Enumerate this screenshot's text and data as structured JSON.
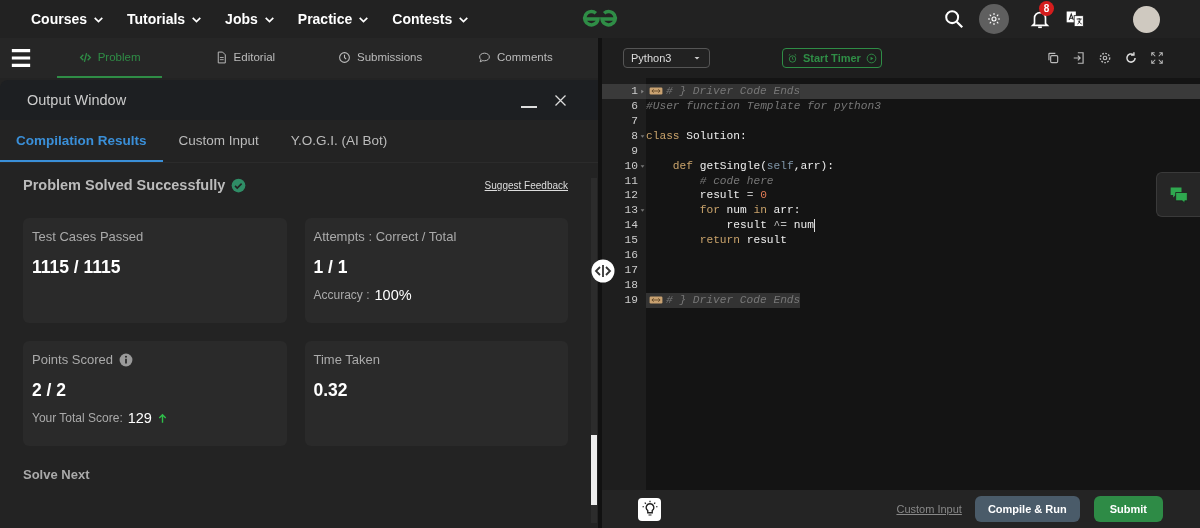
{
  "nav": {
    "menus": [
      "Courses",
      "Tutorials",
      "Jobs",
      "Practice",
      "Contests"
    ],
    "notification_count": "8"
  },
  "problem_tabs": [
    {
      "label": "Problem",
      "kind": "code",
      "selected": true
    },
    {
      "label": "Editorial",
      "kind": "document",
      "selected": false
    },
    {
      "label": "Submissions",
      "kind": "clock",
      "selected": false
    },
    {
      "label": "Comments",
      "kind": "comment",
      "selected": false
    }
  ],
  "output_window": {
    "title": "Output Window",
    "tabs": [
      {
        "label": "Compilation Results",
        "selected": true
      },
      {
        "label": "Custom Input",
        "selected": false
      },
      {
        "label": "Y.O.G.I. (AI Bot)",
        "selected": false
      }
    ],
    "status": "Problem Solved Successfully",
    "feedback_link": "Suggest Feedback",
    "cards": [
      {
        "label": "Test Cases Passed",
        "value": "1115 / 1115"
      },
      {
        "label": "Attempts : Correct / Total",
        "value": "1 / 1",
        "extra_label": "Accuracy :",
        "extra_value": "100%"
      },
      {
        "label": "Points Scored",
        "info": true,
        "value": "2 / 2",
        "extra_label": "Your Total Score:",
        "extra_value": "129",
        "rising": true
      },
      {
        "label": "Time Taken",
        "value": "0.32"
      }
    ],
    "solve_next": "Solve Next"
  },
  "editor": {
    "language": "Python3",
    "timer_button": "Start Timer",
    "lines": [
      {
        "number": "1",
        "folded": true,
        "highlighted": true,
        "folded_block": true,
        "tokens": [
          {
            "kind": "comment",
            "text": "# } Driver Code Ends"
          }
        ]
      },
      {
        "number": "6",
        "tokens": [
          {
            "kind": "comment",
            "text": "#User function Template for python3"
          }
        ]
      },
      {
        "number": "7"
      },
      {
        "number": "8",
        "folded": false,
        "tokens": [
          {
            "kind": "keyword",
            "text": "class"
          },
          {
            "kind": "name",
            "text": " Solution:"
          }
        ]
      },
      {
        "number": "9"
      },
      {
        "number": "10",
        "folded": false,
        "tokens": [
          {
            "kind": "keyword",
            "text": "    def"
          },
          {
            "kind": "name",
            "text": " getSingle("
          },
          {
            "kind": "builtin",
            "text": "self"
          },
          {
            "kind": "name",
            "text": ",arr):"
          }
        ]
      },
      {
        "number": "11",
        "tokens": [
          {
            "kind": "comment",
            "text": "        # code here"
          }
        ]
      },
      {
        "number": "12",
        "tokens": [
          {
            "kind": "name",
            "text": "        result "
          },
          {
            "kind": "operator",
            "text": "="
          },
          {
            "kind": "number",
            "text": " 0"
          }
        ]
      },
      {
        "number": "13",
        "folded": false,
        "tokens": [
          {
            "kind": "keyword",
            "text": "        for"
          },
          {
            "kind": "name",
            "text": " num "
          },
          {
            "kind": "keyword",
            "text": "in"
          },
          {
            "kind": "name",
            "text": " arr:"
          }
        ]
      },
      {
        "number": "14",
        "cursor": true,
        "tokens": [
          {
            "kind": "name",
            "text": "            result "
          },
          {
            "kind": "operator",
            "text": "^="
          },
          {
            "kind": "name",
            "text": " num"
          }
        ]
      },
      {
        "number": "15",
        "tokens": [
          {
            "kind": "keyword",
            "text": "        return"
          },
          {
            "kind": "name",
            "text": " result"
          }
        ]
      },
      {
        "number": "16"
      },
      {
        "number": "17"
      },
      {
        "number": "18"
      },
      {
        "number": "19",
        "folded_block": true,
        "tokens": [
          {
            "kind": "comment",
            "text": "# } Driver Code Ends"
          }
        ]
      }
    ],
    "custom_input_link": "Custom Input",
    "compile_button": "Compile & Run",
    "submit_button": "Submit"
  }
}
